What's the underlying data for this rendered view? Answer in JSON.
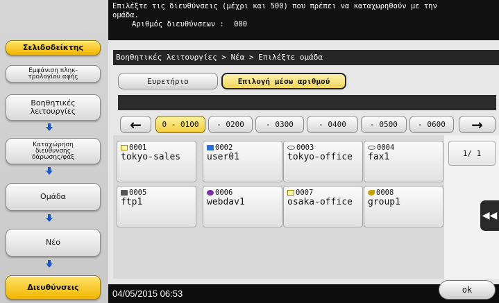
{
  "sidebar": {
    "bookmark_label": "Σελιδοδείκτης",
    "display_mode_label": "Εμφάνιση πληκ-\nτρολογίου αφής",
    "items": [
      {
        "label": "Βοηθητικές\nλειτουργίες"
      },
      {
        "label": "Καταχώρηση\nδιεύθυνσης\nδάρωσης/φάξ"
      },
      {
        "label": "Ομάδα"
      },
      {
        "label": "Νέο"
      },
      {
        "label": "Διευθύνσεις"
      }
    ]
  },
  "message": {
    "line1": "Επιλέξτε τις διευθύνσεις (μέχρι και 500) που πρέπει να καταχωρηθούν με την",
    "line2": "ομάδα.",
    "count_label": "Αριθμός διευθύνσεων :",
    "count_value": "000"
  },
  "breadcrumb": "Βοηθητικές λειτουργίες > Νέα > Επιλέξτε ομάδα",
  "tabs": {
    "index": "Ευρετήριο",
    "by_number": "Επιλογή μέσω αριθμού"
  },
  "ranges": [
    "0 - 0100",
    "- 0200",
    "- 0300",
    "- 0400",
    "- 0500",
    "- 0600"
  ],
  "nav": {
    "prev": "←",
    "next": "→"
  },
  "entries": [
    {
      "number": "0001",
      "name": "tokyo-sales",
      "icon": "mail-icon"
    },
    {
      "number": "0002",
      "name": "user01",
      "icon": "pc-icon"
    },
    {
      "number": "0003",
      "name": "tokyo-office",
      "icon": "fax-icon"
    },
    {
      "number": "0004",
      "name": "fax1",
      "icon": "fax-icon"
    },
    {
      "number": "0005",
      "name": "ftp1",
      "icon": "ftp-icon"
    },
    {
      "number": "0006",
      "name": "webdav1",
      "icon": "webdav-icon"
    },
    {
      "number": "0007",
      "name": "osaka-office",
      "icon": "mail-icon"
    },
    {
      "number": "0008",
      "name": "group1",
      "icon": "group-icon"
    }
  ],
  "pager": "1/  1",
  "footer": {
    "datetime": "04/05/2015  06:53",
    "ok_label": "ok"
  }
}
